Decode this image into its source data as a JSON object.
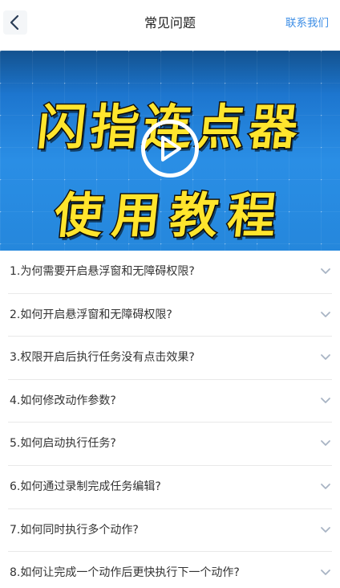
{
  "header": {
    "back_icon": "chevron-left-icon",
    "title": "常见问题",
    "contact_label": "联系我们"
  },
  "banner": {
    "line1": "闪指连点器",
    "line2": "使用教程",
    "play_icon": "play-circle-icon",
    "text_color": "#ffe52d",
    "background_color": "#2a8ee5"
  },
  "faq": {
    "chevron_icon": "chevron-down-icon",
    "items": [
      {
        "question": "1.为何需要开启悬浮窗和无障碍权限?"
      },
      {
        "question": "2.如何开启悬浮窗和无障碍权限?"
      },
      {
        "question": "3.权限开启后执行任务没有点击效果?"
      },
      {
        "question": "4.如何修改动作参数?"
      },
      {
        "question": "5.如何启动执行任务?"
      },
      {
        "question": "6.如何通过录制完成任务编辑?"
      },
      {
        "question": "7.如何同时执行多个动作?"
      },
      {
        "question": "8.如何让完成一个动作后更快执行下一个动作?"
      }
    ]
  },
  "colors": {
    "accent": "#3d8ee6",
    "divider": "#e9e9e9"
  }
}
